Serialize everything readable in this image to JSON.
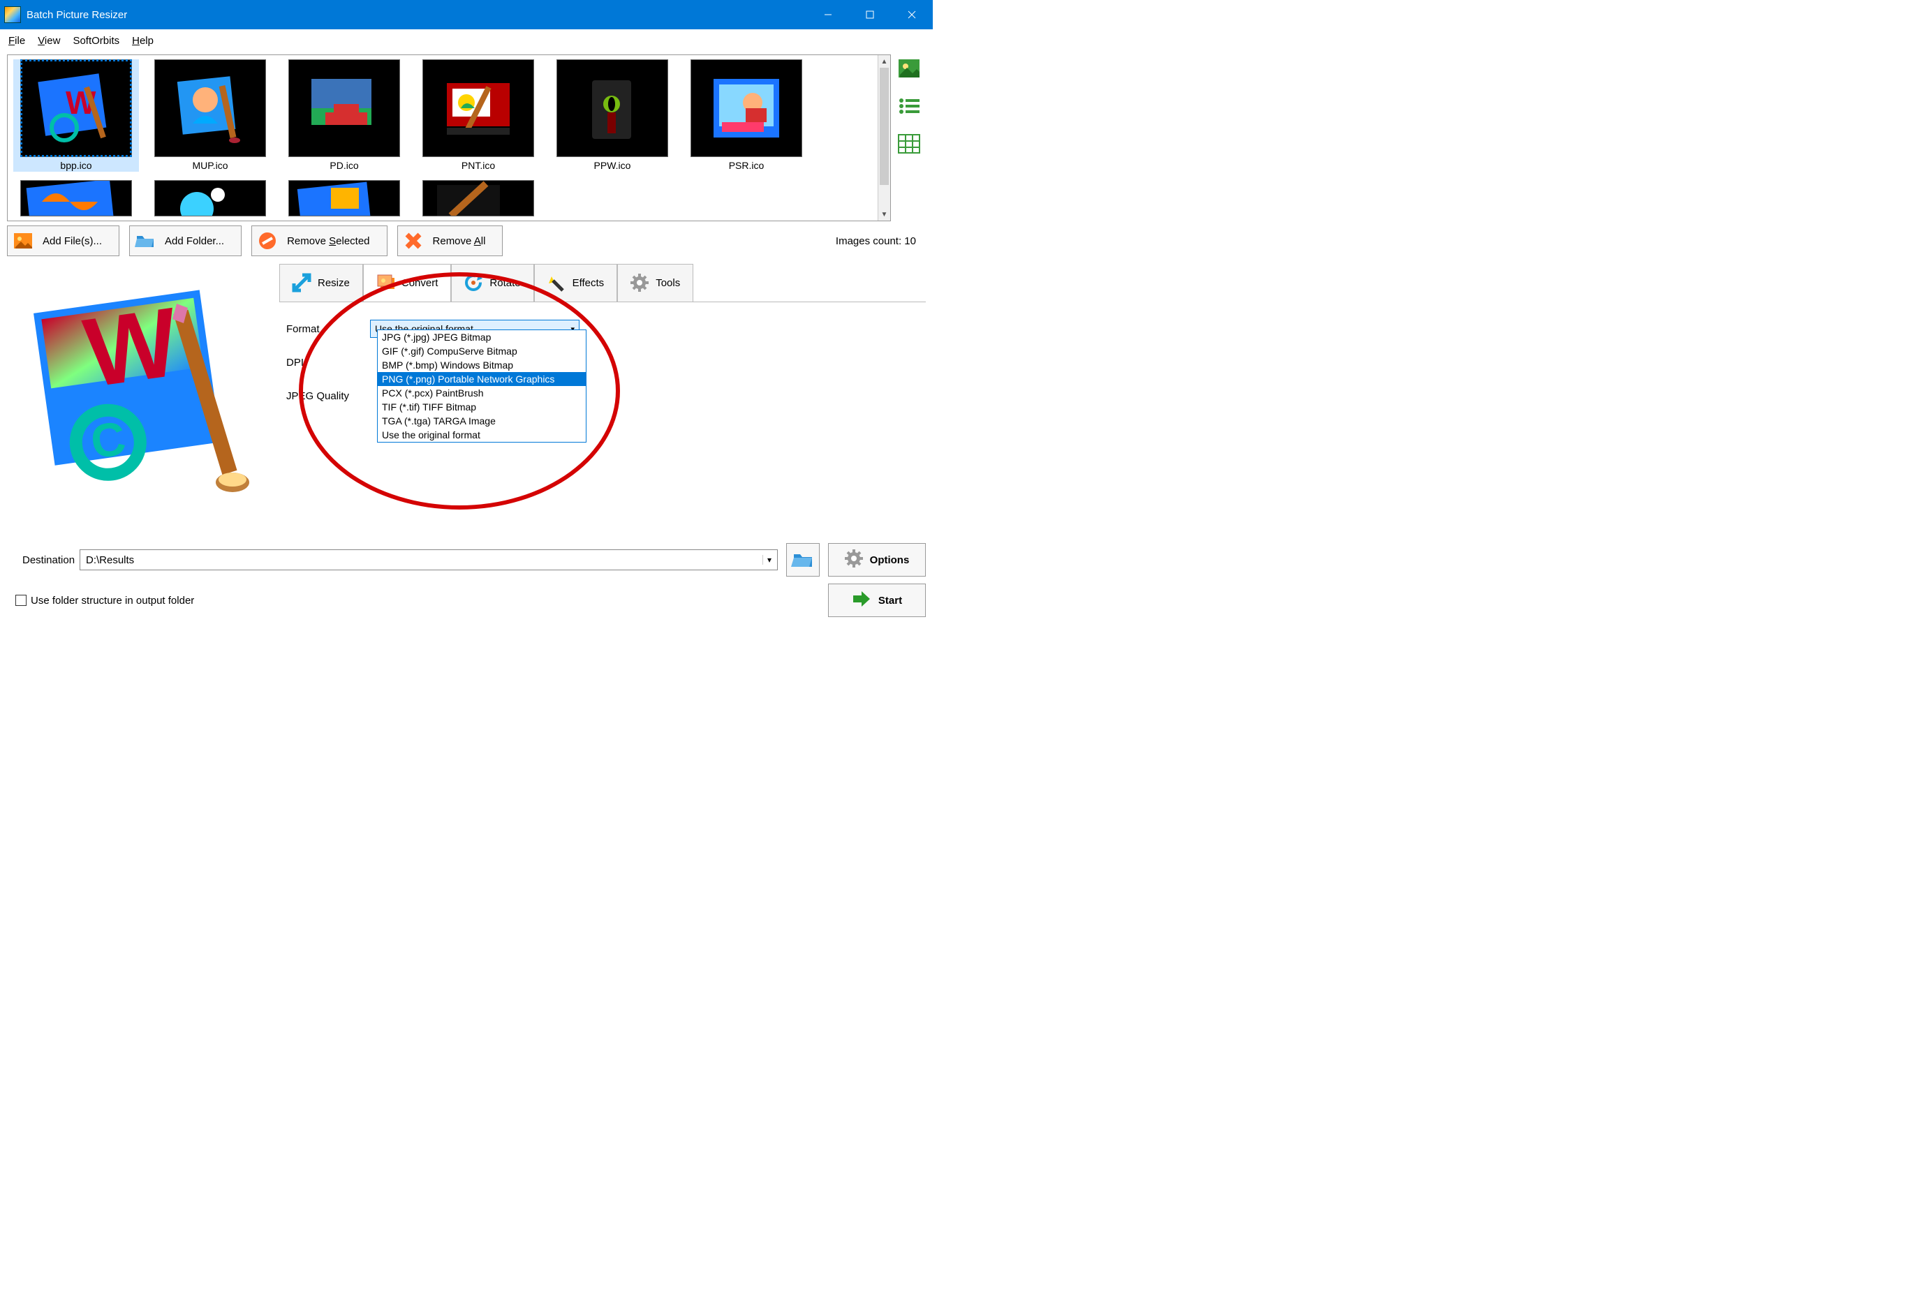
{
  "window": {
    "title": "Batch Picture Resizer"
  },
  "menu": {
    "file": "File",
    "view": "View",
    "softorbits": "SoftOrbits",
    "help": "Help"
  },
  "thumbs": [
    "bpp.ico",
    "MUP.ico",
    "PD.ico",
    "PNT.ico",
    "PPW.ico",
    "PSR.ico"
  ],
  "buttons": {
    "add_files": "Add File(s)...",
    "add_folder": "Add Folder...",
    "remove_selected": "Remove Selected",
    "remove_all": "Remove All"
  },
  "count_label": "Images count: 10",
  "tabs": {
    "resize": "Resize",
    "convert": "Convert",
    "rotate": "Rotate",
    "effects": "Effects",
    "tools": "Tools"
  },
  "convert": {
    "format_label": "Format",
    "dpi_label": "DPI",
    "jpeg_label": "JPEG Quality",
    "selected": "Use the original format",
    "options": [
      "JPG (*.jpg) JPEG Bitmap",
      "GIF (*.gif) CompuServe Bitmap",
      "BMP (*.bmp) Windows Bitmap",
      "PNG (*.png) Portable Network Graphics",
      "PCX (*.pcx) PaintBrush",
      "TIF (*.tif) TIFF Bitmap",
      "TGA (*.tga) TARGA Image",
      "Use the original format"
    ],
    "highlighted_index": 3
  },
  "dest": {
    "label": "Destination",
    "value": "D:\\Results"
  },
  "chk_label": "Use folder structure in output folder",
  "options_btn": "Options",
  "start_btn": "Start"
}
